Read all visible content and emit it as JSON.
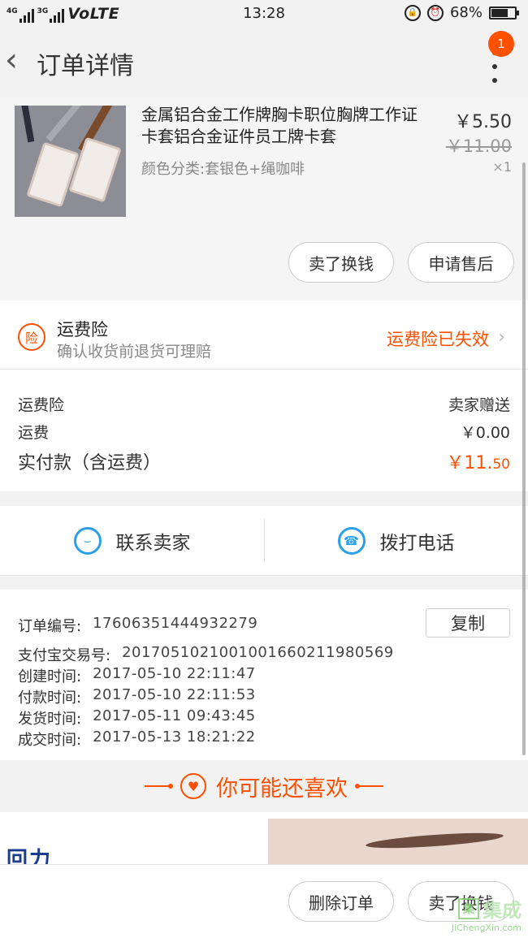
{
  "status_bar": {
    "net1": "4G",
    "net2": "3G",
    "volte": "VoLTE",
    "time": "13:28",
    "battery": "68%",
    "battery_level": 0.68
  },
  "header": {
    "title": "订单详情",
    "badge": "1"
  },
  "product": {
    "name": "金属铝合金工作牌胸卡职位胸牌工作证卡套铝合金证件员工牌卡套",
    "spec": "颜色分类:套银色+绳咖啡",
    "price": "￥5.50",
    "original_price": "￥11.00",
    "quantity": "×1",
    "buttons": {
      "sell": "卖了换钱",
      "after_sale": "申请售后"
    }
  },
  "insurance": {
    "icon_text": "险",
    "title": "运费险",
    "subtitle": "确认收货前退货可理赔",
    "status": "运费险已失效"
  },
  "fees": {
    "rows": [
      {
        "label": "运费险",
        "value": "卖家赠送"
      },
      {
        "label": "运费",
        "value": "￥0.00"
      }
    ],
    "total_label": "实付款（含运费）",
    "total_main": "￥11.",
    "total_cents": "50"
  },
  "contact": {
    "seller": "联系卖家",
    "call": "拨打电话"
  },
  "order_info": {
    "copy_label": "复制",
    "rows": [
      {
        "label": "订单编号:",
        "value": "17606351444932279"
      },
      {
        "label": "支付宝交易号:",
        "value": "2017051021001001660211980569"
      },
      {
        "label": "创建时间:",
        "value": "2017-05-10 22:11:47"
      },
      {
        "label": "付款时间:",
        "value": "2017-05-10 22:11:53"
      },
      {
        "label": "发货时间:",
        "value": "2017-05-11 09:43:45"
      },
      {
        "label": "成交时间:",
        "value": "2017-05-13 18:21:22"
      }
    ]
  },
  "recommend": {
    "title": "你可能还喜欢"
  },
  "ads": {
    "brand_text": "回力"
  },
  "bottom_bar": {
    "delete": "删除订单",
    "sell": "卖了换钱"
  },
  "watermark": {
    "logo": "集成",
    "url": "JiChengXin.com"
  },
  "colors": {
    "accent": "#ff5000",
    "contact_blue": "#2aa0e8"
  }
}
